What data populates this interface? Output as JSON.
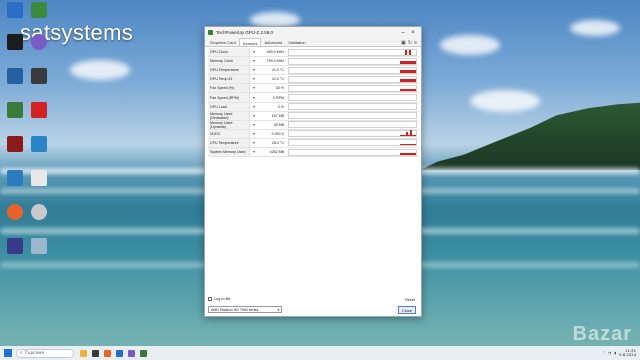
{
  "watermark": "satsystems",
  "bazar": "Bazar",
  "desktop_icons": [
    {
      "label": "",
      "color": "#2a6ec6"
    },
    {
      "label": "",
      "color": "#3c8b3c"
    },
    {
      "label": "",
      "color": "#1d1d1d"
    },
    {
      "label": "",
      "color": "#2560a0"
    },
    {
      "label": "",
      "color": "#3a88c7"
    },
    {
      "label": "",
      "color": "#3a7a3a"
    },
    {
      "label": "",
      "color": "#b52020"
    },
    {
      "label": "",
      "color": "#b22"
    },
    {
      "label": "",
      "color": "#2d7bbf"
    },
    {
      "label": "",
      "color": "#2a84c8"
    },
    {
      "label": "",
      "color": "#d8552a"
    },
    {
      "label": "",
      "color": "#2a6ec6"
    }
  ],
  "window": {
    "title": "TechPowerUp GPU-Z 2.59.0",
    "tabs": [
      "Graphics Card",
      "Sensors",
      "Advanced",
      "Validation"
    ],
    "active_tab": "Sensors",
    "sensors": [
      {
        "name": "GPU Clock",
        "value": "469.0 MHz"
      },
      {
        "name": "Memory Clock",
        "value": "799.9 MHz"
      },
      {
        "name": "GPU Temperature",
        "value": "41.0 °C"
      },
      {
        "name": "GPU Temp #1",
        "value": "41.0 °C"
      },
      {
        "name": "Fan Speed (%)",
        "value": "30 %"
      },
      {
        "name": "Fan Speed (RPM)",
        "value": "0 RPM"
      },
      {
        "name": "GPU Load",
        "value": "0 %"
      },
      {
        "name": "Memory Used (Dedicated)",
        "value": "157 MB"
      },
      {
        "name": "Memory Used (Dynamic)",
        "value": "26 MB"
      },
      {
        "name": "VDDC",
        "value": "0.900 V"
      },
      {
        "name": "CPU Temperature",
        "value": "28.0 °C"
      },
      {
        "name": "System Memory Used",
        "value": "4262 MB"
      }
    ],
    "log_to_file_label": "Log to file",
    "reset_label": "Reset",
    "gpu_select_value": "AMD Radeon HD 7900 series",
    "close_label": "Close"
  },
  "taskbar": {
    "search_placeholder": "Търсене",
    "time": "11:31",
    "date": "5.8.2024"
  }
}
